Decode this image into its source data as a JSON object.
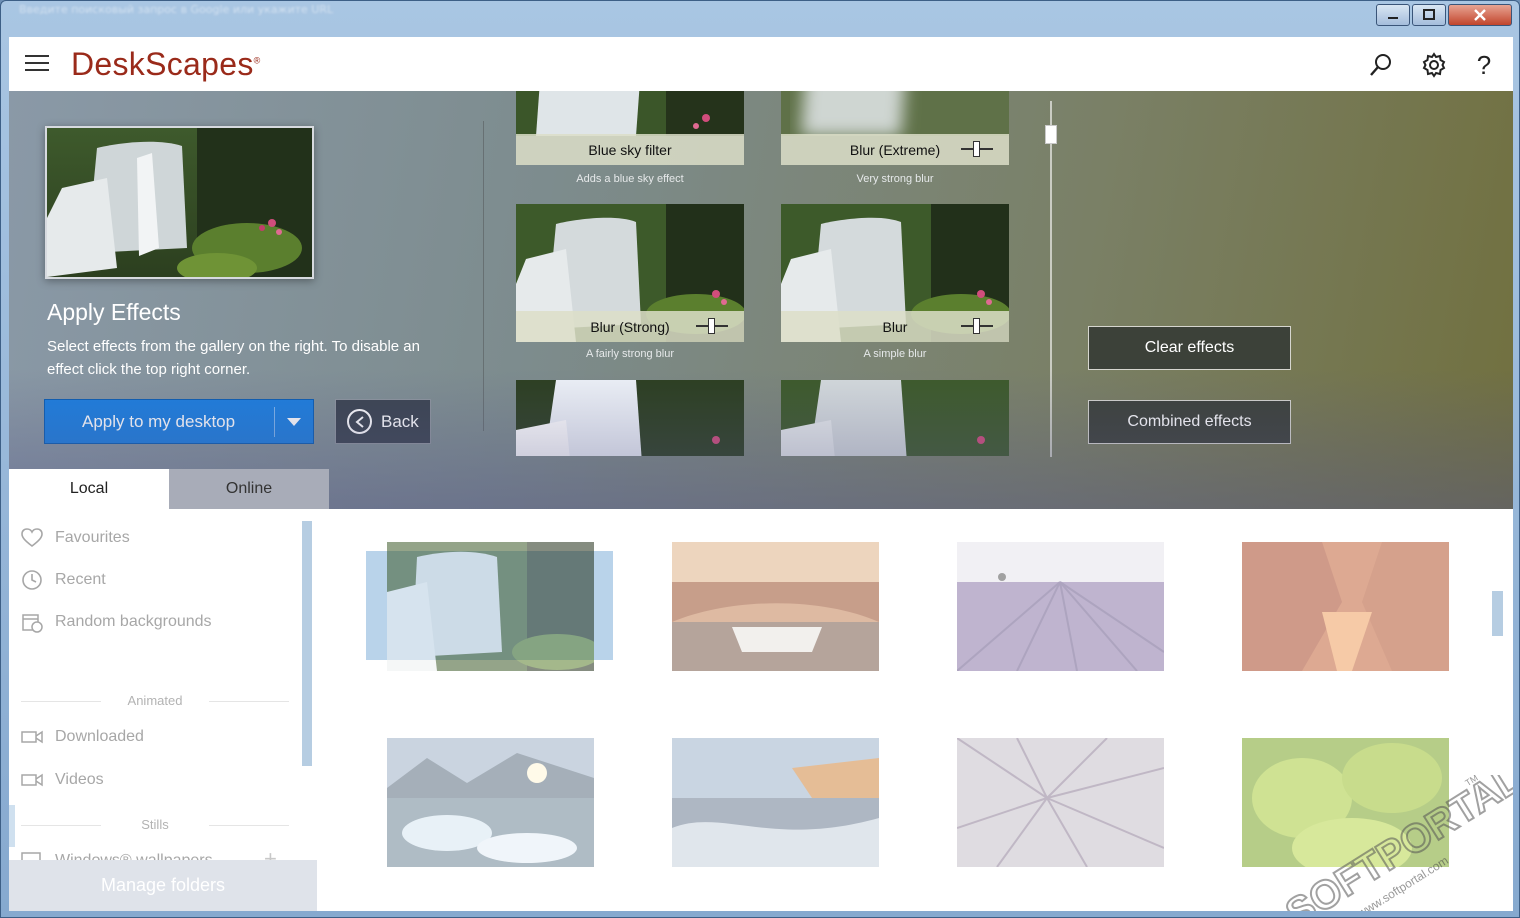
{
  "window": {
    "title": "Введите поисковый запрос в Google или укажите URL"
  },
  "header": {
    "logo_text": "DeskScapes",
    "logo_mark": "®",
    "icons": [
      "search-icon",
      "gear-icon",
      "help-icon"
    ]
  },
  "effects_panel": {
    "title": "Apply Effects",
    "description": "Select effects from the gallery on the right.  To disable an effect click the top right corner.",
    "apply_label": "Apply to my desktop",
    "back_label": "Back",
    "clear_label": "Clear effects",
    "combined_label": "Combined effects",
    "tiles": [
      {
        "name": "Blue sky filter",
        "desc": "Adds a blue sky effect",
        "slider": false
      },
      {
        "name": "Blur (Extreme)",
        "desc": "Very strong blur",
        "slider": true
      },
      {
        "name": "Blur (Strong)",
        "desc": "A fairly strong blur",
        "slider": true
      },
      {
        "name": "Blur",
        "desc": "A simple blur",
        "slider": true
      }
    ]
  },
  "tabs": {
    "local": "Local",
    "online": "Online",
    "active": "Local"
  },
  "sidebar": {
    "favourites": "Favourites",
    "recent": "Recent",
    "random": "Random backgrounds",
    "animated_heading": "Animated",
    "downloaded": "Downloaded",
    "videos": "Videos",
    "stills_heading": "Stills",
    "windows_wallpapers": "Windows® wallpapers",
    "add_symbol": "+",
    "manage_folders": "Manage folders"
  },
  "gallery": {
    "thumbnails": [
      "Waterfall",
      "Rock arch",
      "Lavender field",
      "Red canyon",
      "Glacier ice",
      "Coastal waves",
      "Frost spikes",
      "Green succulent"
    ],
    "selected_index": 0
  },
  "watermark": {
    "brand": "SOFTPORTAL",
    "url": "www.softportal.com",
    "tm": "TM"
  },
  "colors": {
    "accent_blue": "#1c7fe0",
    "logo_red": "#9a2a1a"
  }
}
